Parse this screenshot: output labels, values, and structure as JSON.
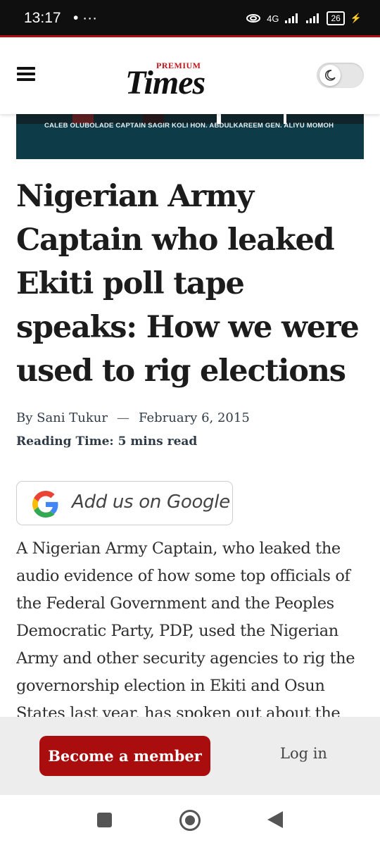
{
  "status_bar": {
    "time": "13:17",
    "overflow": "• ···",
    "network": "4G",
    "battery": "26"
  },
  "header": {
    "logo_premium": "PREMIUM",
    "logo_times": "Times"
  },
  "banner": {
    "caption": "CALEB OLUBOLADE   CAPTAIN SAGIR KOLI   HON. ABDULKAREEM   GEN. ALIYU MOMOH"
  },
  "article": {
    "title": "Nigerian Army Captain who leaked Ekiti poll tape speaks: How we were used to rig elections",
    "byline": "By Sani Tukur",
    "separator": "—",
    "date": "February 6, 2015",
    "reading_time": "Reading Time: 5 mins read",
    "body": "A Nigerian Army Captain, who leaked the audio evidence of how some top officials of the Federal Government and the Peoples Democratic Party, PDP, used the Nigerian Army and other security agencies to rig the governorship election in Ekiti and Osun States last year, has spoken out about the"
  },
  "google_button": {
    "label": "Add us on Google"
  },
  "member_bar": {
    "become_member": "Become a member",
    "login": "Log in"
  },
  "colors": {
    "brand_red": "#a90d0d",
    "logo_red": "#c4141b",
    "banner_bg": "#0d3b48"
  }
}
